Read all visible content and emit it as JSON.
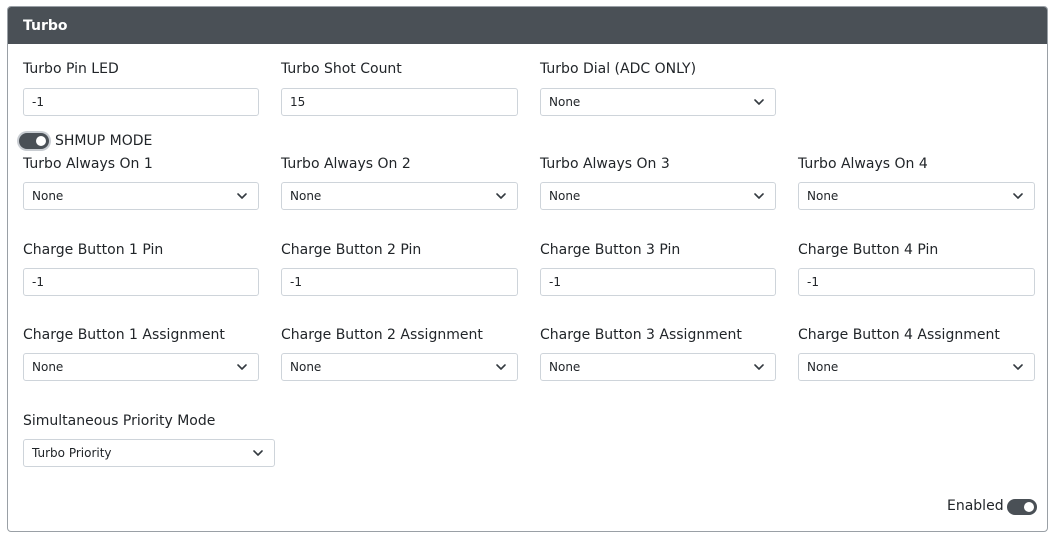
{
  "card": {
    "title": "Turbo"
  },
  "turbo_pin_led": {
    "label": "Turbo Pin LED",
    "value": "-1"
  },
  "turbo_shot_count": {
    "label": "Turbo Shot Count",
    "value": "15"
  },
  "turbo_dial": {
    "label": "Turbo Dial (ADC ONLY)",
    "value": "None"
  },
  "shmup_mode": {
    "label": "SHMUP MODE",
    "on": true
  },
  "always_on": [
    {
      "label": "Turbo Always On 1",
      "value": "None"
    },
    {
      "label": "Turbo Always On 2",
      "value": "None"
    },
    {
      "label": "Turbo Always On 3",
      "value": "None"
    },
    {
      "label": "Turbo Always On 4",
      "value": "None"
    }
  ],
  "charge_pins": [
    {
      "label": "Charge Button 1 Pin",
      "value": "-1"
    },
    {
      "label": "Charge Button 2 Pin",
      "value": "-1"
    },
    {
      "label": "Charge Button 3 Pin",
      "value": "-1"
    },
    {
      "label": "Charge Button 4 Pin",
      "value": "-1"
    }
  ],
  "charge_assignments": [
    {
      "label": "Charge Button 1 Assignment",
      "value": "None"
    },
    {
      "label": "Charge Button 2 Assignment",
      "value": "None"
    },
    {
      "label": "Charge Button 3 Assignment",
      "value": "None"
    },
    {
      "label": "Charge Button 4 Assignment",
      "value": "None"
    }
  ],
  "priority_mode": {
    "label": "Simultaneous Priority Mode",
    "value": "Turbo Priority"
  },
  "enabled": {
    "label": "Enabled",
    "on": true
  }
}
